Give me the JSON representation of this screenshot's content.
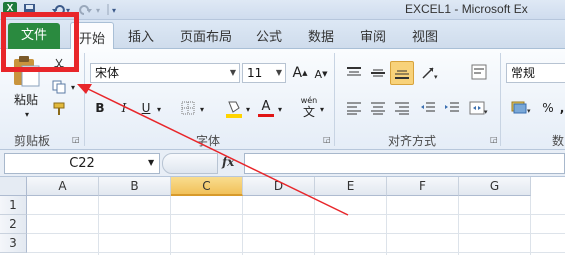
{
  "window": {
    "title": "EXCEL1 - Microsoft Ex",
    "app_icon_letter": "X"
  },
  "quick_access": {
    "save_icon": "save-icon",
    "undo_icon": "undo-icon",
    "redo_icon": "redo-icon",
    "customize_icon": "customize-icon"
  },
  "tabs": {
    "file": "文件",
    "home": "开始",
    "insert": "插入",
    "page_layout": "页面布局",
    "formulas": "公式",
    "data": "数据",
    "review": "审阅",
    "view": "视图"
  },
  "clipboard": {
    "paste_label": "粘贴",
    "group_label": "剪贴板"
  },
  "font": {
    "family": "宋体",
    "size": "11",
    "group_label": "字体",
    "bold": "B",
    "italic": "I",
    "underline": "U",
    "grow": "A",
    "shrink": "A",
    "color_letter": "A",
    "wen_label": "wén",
    "wen_char": "文"
  },
  "alignment": {
    "group_label": "对齐方式"
  },
  "number": {
    "format": "常规",
    "group_label": "数",
    "percent": "%",
    "comma": ","
  },
  "formula_bar": {
    "name_box": "C22",
    "fx_label": "fx",
    "value": ""
  },
  "sheet": {
    "columns": [
      "A",
      "B",
      "C",
      "D",
      "E",
      "F",
      "G"
    ],
    "rows": [
      "1",
      "2",
      "3"
    ],
    "selected_column": "C"
  },
  "colors": {
    "file_tab": "#2a8a3f",
    "annotation": "#e8262a",
    "selected_header": "#f1c15a"
  }
}
